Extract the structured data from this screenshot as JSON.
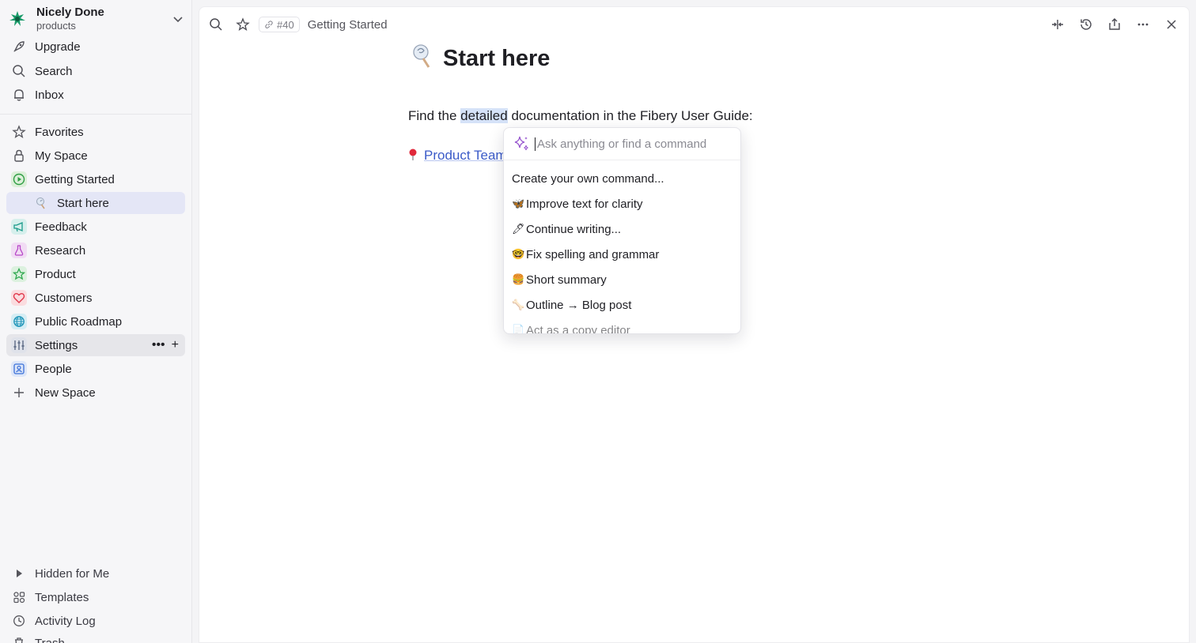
{
  "workspace": {
    "name": "Nicely Done",
    "subtitle": "products"
  },
  "sidebar": {
    "top": [
      {
        "label": "Upgrade"
      },
      {
        "label": "Search"
      },
      {
        "label": "Inbox"
      }
    ],
    "spaces": [
      {
        "label": "Favorites"
      },
      {
        "label": "My Space"
      },
      {
        "label": "Getting Started"
      },
      {
        "label": "Start here"
      },
      {
        "label": "Feedback"
      },
      {
        "label": "Research"
      },
      {
        "label": "Product"
      },
      {
        "label": "Customers"
      },
      {
        "label": "Public Roadmap"
      },
      {
        "label": "Settings"
      },
      {
        "label": "People"
      },
      {
        "label": "New Space"
      }
    ],
    "bottom": [
      {
        "label": "Hidden for Me"
      },
      {
        "label": "Templates"
      },
      {
        "label": "Activity Log"
      },
      {
        "label": "Trash"
      }
    ]
  },
  "topbar": {
    "entity_id": "#40",
    "breadcrumb": "Getting Started"
  },
  "document": {
    "title": "Start here",
    "para_before": "Find the ",
    "para_highlight": "detailed",
    "para_after": " documentation in the Fibery User Guide:",
    "link_text": "Product Team"
  },
  "ai_popup": {
    "placeholder": "Ask anything or find a command",
    "commands": [
      {
        "emoji": "",
        "label": "Create your own command..."
      },
      {
        "emoji": "🦋",
        "label": "Improve text for clarity"
      },
      {
        "emoji": "🖊",
        "label": "Continue writing..."
      },
      {
        "emoji": "🤓",
        "label": "Fix spelling and grammar"
      },
      {
        "emoji": "🍔",
        "label": "Short summary"
      },
      {
        "emoji": "🦴",
        "label": "Outline → Blog post"
      },
      {
        "emoji": "📄",
        "label": "Act as a copy editor"
      }
    ]
  },
  "colors": {
    "accent_active": "#e4e6f6",
    "link": "#3b5bc8",
    "highlight": "#d5e2f8",
    "getting_started": "#2f9e44",
    "feedback": "#1b9a8a",
    "research": "#b646c7",
    "product": "#2fa84f",
    "customers": "#e0364a",
    "roadmap": "#1d94b8",
    "people": "#3a6fd8"
  }
}
